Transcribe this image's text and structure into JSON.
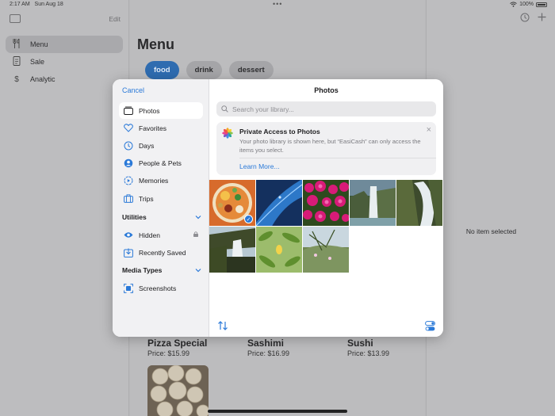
{
  "status": {
    "time": "2:17 AM",
    "date": "Sun Aug 18",
    "battery": "100%"
  },
  "sidebar": {
    "edit_label": "Edit",
    "items": [
      {
        "label": "Menu",
        "icon": "fork-knife-icon"
      },
      {
        "label": "Sale",
        "icon": "receipt-icon"
      },
      {
        "label": "Analytic",
        "icon": "dollar-icon"
      }
    ]
  },
  "main": {
    "title": "Menu",
    "chips": [
      "food",
      "drink",
      "dessert"
    ],
    "active_chip": "food",
    "items": [
      {
        "name": "Pizza Special",
        "price": "Price: $15.99"
      },
      {
        "name": "Sashimi",
        "price": "Price: $16.99"
      },
      {
        "name": "Sushi",
        "price": "Price: $13.99"
      }
    ]
  },
  "detail": {
    "empty_text": "No item selected"
  },
  "picker": {
    "cancel_label": "Cancel",
    "title": "Photos",
    "search_placeholder": "Search your library...",
    "nav": [
      {
        "label": "Photos",
        "icon": "photos-icon",
        "selected": true
      },
      {
        "label": "Favorites",
        "icon": "heart-icon"
      },
      {
        "label": "Days",
        "icon": "clock-icon"
      },
      {
        "label": "People & Pets",
        "icon": "person-icon"
      },
      {
        "label": "Memories",
        "icon": "memories-icon"
      },
      {
        "label": "Trips",
        "icon": "suitcase-icon"
      }
    ],
    "utilities": {
      "label": "Utilities",
      "items": [
        {
          "label": "Hidden",
          "icon": "eye-icon",
          "locked": true
        },
        {
          "label": "Recently Saved",
          "icon": "download-icon"
        }
      ]
    },
    "media_types": {
      "label": "Media Types",
      "items": [
        {
          "label": "Screenshots",
          "icon": "screenshot-icon"
        }
      ]
    },
    "notice": {
      "title": "Private Access to Photos",
      "text": "Your photo library is shown here, but “EasiCash” can only access the items you select.",
      "link": "Learn More..."
    },
    "photos": [
      {
        "subject": "food-bowl",
        "selected": true
      },
      {
        "subject": "leaf-closeup",
        "selected": false
      },
      {
        "subject": "pink-flowers",
        "selected": false
      },
      {
        "subject": "waterfall",
        "selected": false
      },
      {
        "subject": "waterfall-rocks",
        "selected": false
      },
      {
        "subject": "waterfall-cliff",
        "selected": false
      },
      {
        "subject": "yellow-flower",
        "selected": false
      },
      {
        "subject": "plant-hillside",
        "selected": false
      }
    ]
  },
  "colors": {
    "accent": "#2a79d8",
    "active_chip": "#2f6cb0"
  }
}
